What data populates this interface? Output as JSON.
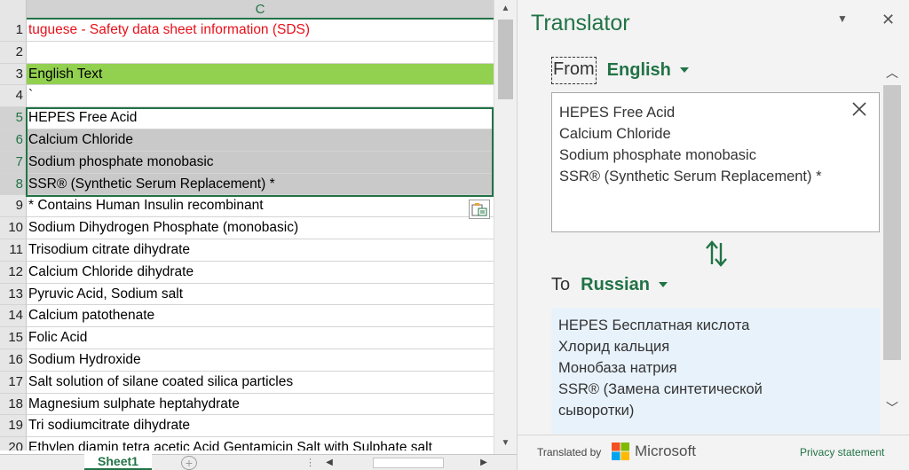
{
  "sheet": {
    "column_header": "C",
    "rows": [
      {
        "num": "1",
        "text": "tuguese - Safety data sheet information (SDS)"
      },
      {
        "num": "2",
        "text": ""
      },
      {
        "num": "3",
        "text": "English Text"
      },
      {
        "num": "4",
        "text": "`"
      },
      {
        "num": "5",
        "text": "HEPES Free Acid"
      },
      {
        "num": "6",
        "text": "Calcium Chloride"
      },
      {
        "num": "7",
        "text": "Sodium phosphate monobasic"
      },
      {
        "num": "8",
        "text": "SSR® (Synthetic Serum Replacement) *"
      },
      {
        "num": "9",
        "text": "* Contains Human Insulin recombinant"
      },
      {
        "num": "10",
        "text": "Sodium Dihydrogen Phosphate (monobasic)"
      },
      {
        "num": "11",
        "text": "Trisodium citrate dihydrate"
      },
      {
        "num": "12",
        "text": "Calcium Chloride dihydrate"
      },
      {
        "num": "13",
        "text": "Pyruvic Acid, Sodium salt"
      },
      {
        "num": "14",
        "text": "Calcium patothenate"
      },
      {
        "num": "15",
        "text": "Folic Acid"
      },
      {
        "num": "16",
        "text": "Sodium Hydroxide"
      },
      {
        "num": "17",
        "text": "Salt solution of silane coated silica particles"
      },
      {
        "num": "18",
        "text": "Magnesium sulphate heptahydrate"
      },
      {
        "num": "19",
        "text": "Tri sodiumcitrate dihydrate"
      },
      {
        "num": "20",
        "text": "Ethylen diamin tetra acetic Acid Gentamicin Salt with Sulphate salt"
      }
    ],
    "tab_label": "Sheet1",
    "add_sheet": "+",
    "tab_dots": "⋮"
  },
  "translator": {
    "title": "Translator",
    "from_label": "From",
    "from_lang": "English",
    "source_lines": [
      "HEPES Free Acid",
      "Calcium Chloride",
      "Sodium phosphate monobasic",
      "SSR® (Synthetic Serum Replacement) *"
    ],
    "to_label": "To",
    "to_lang": "Russian",
    "target_lines": [
      "HEPES Бесплатная кислота",
      "Хлорид кальция",
      "Монобаза натрия",
      "SSR® (Замена синтетической сыворотки)"
    ],
    "translated_by": "Translated by",
    "brand": "Microsoft",
    "privacy": "Privacy statement"
  },
  "colors": {
    "accent": "#217346",
    "header_red": "#e8101a",
    "highlight_green": "#92d050",
    "selection_gray": "#c9c9c9",
    "target_bg": "#e8f2fb"
  }
}
